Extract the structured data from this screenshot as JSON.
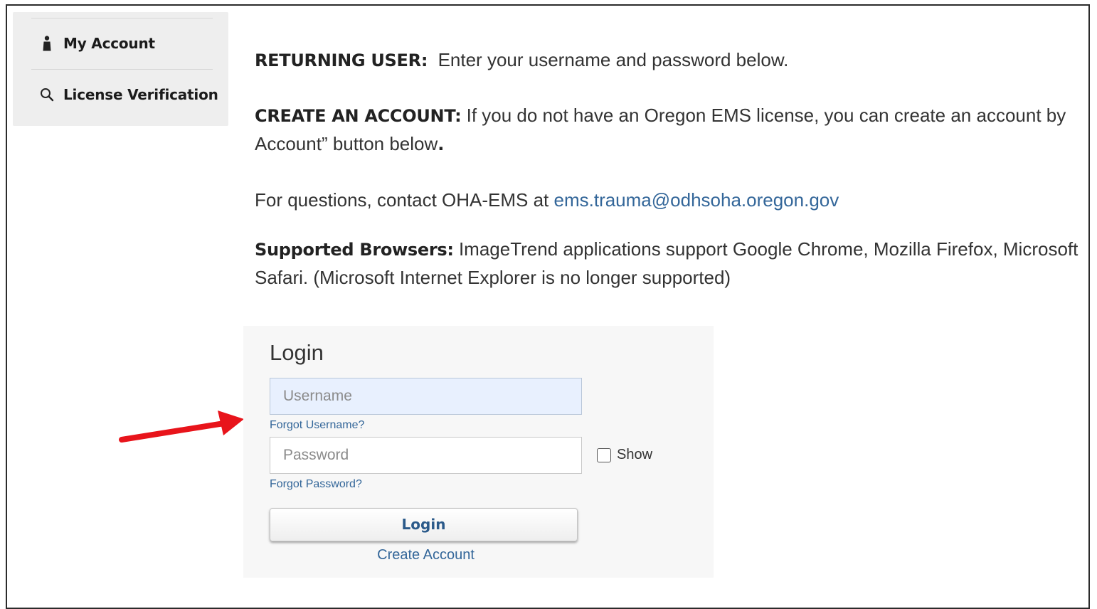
{
  "sidebar": {
    "items": [
      {
        "label": "My Account",
        "icon": "person-icon"
      },
      {
        "label": "License Verification",
        "icon": "search-icon"
      }
    ]
  },
  "main": {
    "returning": {
      "heading": "RETURNING USER:",
      "text": "  Enter your username and password below."
    },
    "create": {
      "heading": "CREATE AN ACCOUNT:",
      "text_line1": " If you do not have an Oregon EMS license, you can create an account by",
      "text_line2": "Account” button below",
      "text_line2_end": "."
    },
    "questions": {
      "text": "For questions, contact OHA-EMS at ",
      "email": "ems.trauma@odhsoha.oregon.gov"
    },
    "browsers": {
      "heading": "Supported Browsers:",
      "text_line1": " ImageTrend applications support Google Chrome, Mozilla Firefox, Microsoft",
      "text_line2": "Safari. (Microsoft Internet Explorer is no longer supported)"
    }
  },
  "login": {
    "title": "Login",
    "username_placeholder": "Username",
    "forgot_username": "Forgot Username?",
    "password_placeholder": "Password",
    "show_label": "Show",
    "show_checked": false,
    "forgot_password": "Forgot Password?",
    "login_button": "Login",
    "create_account": "Create Account"
  },
  "colors": {
    "link": "#336699",
    "arrow": "#e8141b",
    "sidebar_bg": "#eeeeee",
    "panel_bg": "#f7f7f7",
    "username_bg": "#e8f0fe"
  }
}
